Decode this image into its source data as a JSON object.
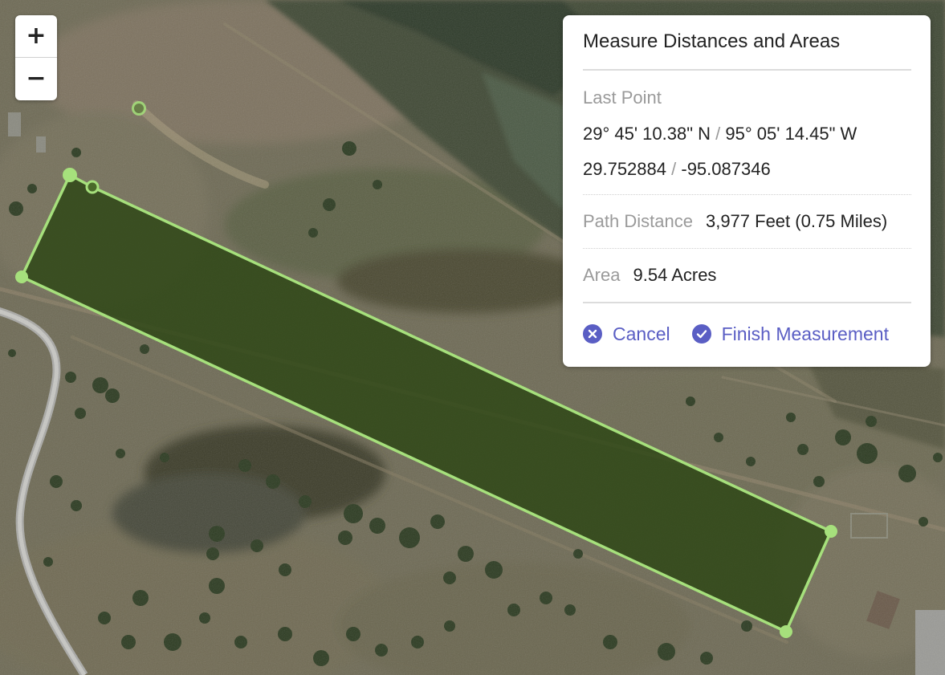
{
  "zoom": {
    "in_label": "+",
    "out_label": "−"
  },
  "panel": {
    "title": "Measure Distances and Areas",
    "last_point_label": "Last Point",
    "dms_lat": "29° 45' 10.38\" N",
    "dms_sep": "/",
    "dms_lon": "95° 05' 14.45\" W",
    "dec_lat": "29.752884",
    "dec_sep": "/",
    "dec_lon": "-95.087346",
    "path_distance_label": "Path Distance",
    "path_distance_value": "3,977 Feet (0.75 Miles)",
    "area_label": "Area",
    "area_value": "9.54 Acres",
    "cancel_label": "Cancel",
    "finish_label": "Finish Measurement"
  },
  "colors": {
    "accent": "#5a5ec4",
    "measure_line": "#a6e07c",
    "measure_fill": "#2c4514"
  },
  "icons": {
    "cancel": "x-circle-icon",
    "finish": "check-circle-icon"
  }
}
